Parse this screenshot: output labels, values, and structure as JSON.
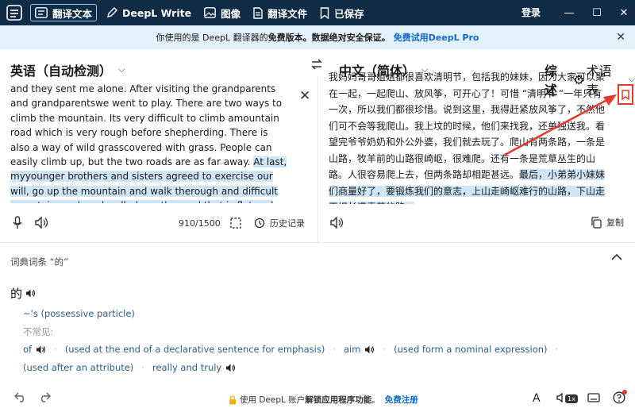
{
  "titlebar": {
    "tabs": [
      {
        "label": "翻译文本",
        "icon": "translate-icon"
      },
      {
        "label": "DeepL Write",
        "icon": "pen-icon"
      },
      {
        "label": "图像",
        "icon": "image-icon"
      },
      {
        "label": "翻译文件",
        "icon": "document-icon"
      },
      {
        "label": "已保存",
        "icon": "bookmark-icon"
      }
    ],
    "login": "登录"
  },
  "banner": {
    "prefix": "你使用的是 DeepL 翻译器的",
    "bold1": "免费版本。",
    "bold2": "数据绝对安全保证。",
    "promo": "免费试用DeepL Pro"
  },
  "source": {
    "lang": "英语（自动检测）",
    "text_plain": "and they sent me alone. After visiting the grandparents and grandparentswe went to play. There are two ways to climb the mountain. Its very difficult to climb amountain road which is very rough before shepherding. There is also a way of wild grasscovered with grass. People can easily climb up, but the two roads are as far away. ",
    "text_highlight": "At last, myyounger brothers and sisters agreed to exercise our will, go up the mountain and walk therough and difficult mountain road, and walk down the road that is flat and full of gra",
    "counter": "910/1500",
    "history": "历史记录"
  },
  "target": {
    "lang": "中文（简体）",
    "glossary": "综述",
    "formality": "术语表",
    "text_plain": "我妈妈哥哥姐姐都很喜欢清明节，包括我的妹妹，因为大家可以聚在一起，一起爬山、放风筝，可开心了！可惜 “清明节 “一年只有一次，所以我们都很珍惜。说到这里，我得赶紧放风筝了，不然他们可不会等我爬山。我上坟的时候，他们来找我，还单独送我。看望完爷爷奶奶和外公外婆，我们就去玩了。爬山有两条路，一条是山路，牧羊前的山路很崎岖，很难爬。还有一条是荒草丛生的山路。人很容易爬上去，但两条路却相距甚远。",
    "text_highlight": "最后，小弟弟小妹妹们商量好了，要锻炼我们的意志，上山走崎岖难行的山路，下山走平坦长满青草的路。",
    "copy": "复制"
  },
  "dictionary": {
    "heading": "词典词条 “的”",
    "word": "的",
    "sense1": "~'s (possessive particle)",
    "uncommon_label": "不常见:",
    "entries": [
      {
        "text": "of",
        "audio": true
      },
      {
        "text": "(used at the end of a declarative sentence for emphasis)",
        "audio": false
      },
      {
        "text": "aim",
        "audio": true
      },
      {
        "text": "(used form a nominal expression)",
        "audio": false
      },
      {
        "text": "(used after an attribute)",
        "audio": false
      },
      {
        "text": "really and truly",
        "audio": true
      }
    ]
  },
  "footer": {
    "text_pre": "使用 DeepL 账户",
    "text_bold": "解锁应用程序功能",
    "text_post": "。",
    "link": "免费注册",
    "speed": "1x"
  },
  "colors": {
    "titlebar": "#0f2b46",
    "banner": "#e3f1fb",
    "highlight": "#cfe5f8",
    "accent": "#0f69c9",
    "annotation": "#e23b2e"
  }
}
